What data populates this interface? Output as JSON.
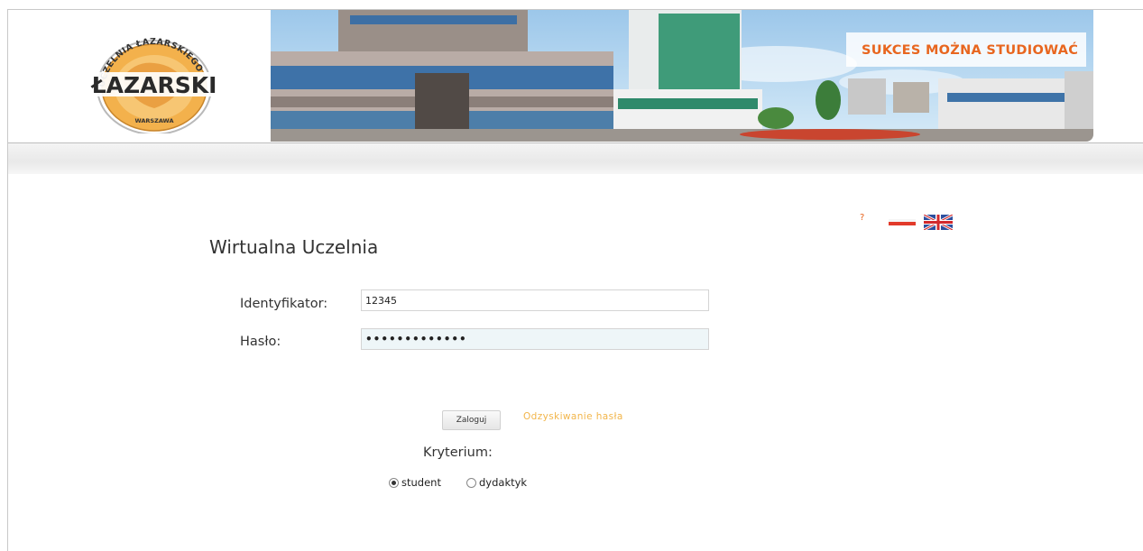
{
  "header": {
    "logo": {
      "arc_text": "UCZELNIA ŁAZARSKIEGO",
      "main_text": "ŁAZARSKI",
      "city_text": "WARSZAWA"
    },
    "slogan": "SUKCES MOŻNA STUDIOWAĆ"
  },
  "tools": {
    "help_label": "?",
    "languages": [
      "pl-flag-icon",
      "en-flag-icon"
    ]
  },
  "form": {
    "title": "Wirtualna Uczelnia",
    "id_label": "Identyfikator:",
    "id_value": "12345",
    "password_label": "Hasło:",
    "password_value": "•••••••••••••",
    "login_button": "Zaloguj",
    "recover_link": "Odzyskiwanie hasła",
    "criterion_label": "Kryterium:",
    "criterion_options": [
      {
        "label": "student",
        "selected": true
      },
      {
        "label": "dydaktyk",
        "selected": false
      }
    ]
  },
  "colors": {
    "accent_orange": "#e8661f",
    "link_orange": "#f2b54a",
    "logo_gold": "#f0a23c"
  }
}
